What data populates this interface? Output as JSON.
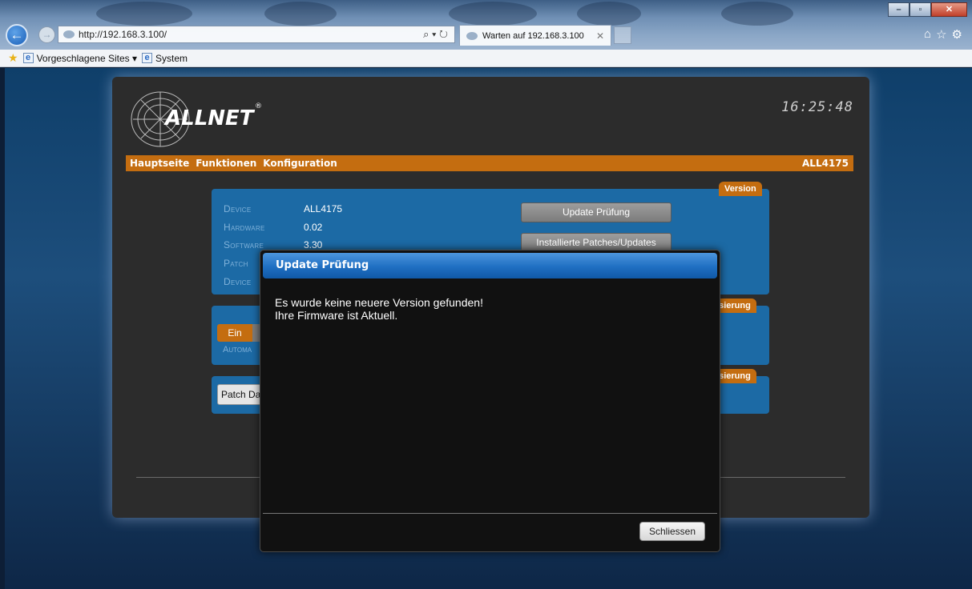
{
  "browser": {
    "address": "http://192.168.3.100/",
    "tab_title": "Warten auf 192.168.3.100",
    "favorites": [
      "Vorgeschlagene Sites ▾",
      "System"
    ]
  },
  "page": {
    "logo_text": "ALLNET",
    "clock": "16:25:48",
    "nav": [
      "Hauptseite",
      "Funktionen",
      "Konfiguration"
    ],
    "nav_device": "ALL4175",
    "version_tag": "Version",
    "info": [
      {
        "key": "Device",
        "value": "ALL4175"
      },
      {
        "key": "Hardware",
        "value": "0.02"
      },
      {
        "key": "Software",
        "value": "3.30"
      },
      {
        "key": "Patch",
        "value": ""
      },
      {
        "key": "Device",
        "value": ""
      }
    ],
    "buttons": {
      "update_check": "Update Prüfung",
      "installed_patches": "Installierte Patches/Updates"
    },
    "box2_tag": "lisierung",
    "box3_tag": "lisierung",
    "toggle_on": "Ein",
    "automatic_label": "Automa",
    "patch_button": "Patch Da"
  },
  "modal": {
    "title": "Update Prüfung",
    "line1": "Es wurde keine neuere Version gefunden!",
    "line2": "Ihre Firmware ist Aktuell.",
    "close_button": "Schliessen"
  }
}
